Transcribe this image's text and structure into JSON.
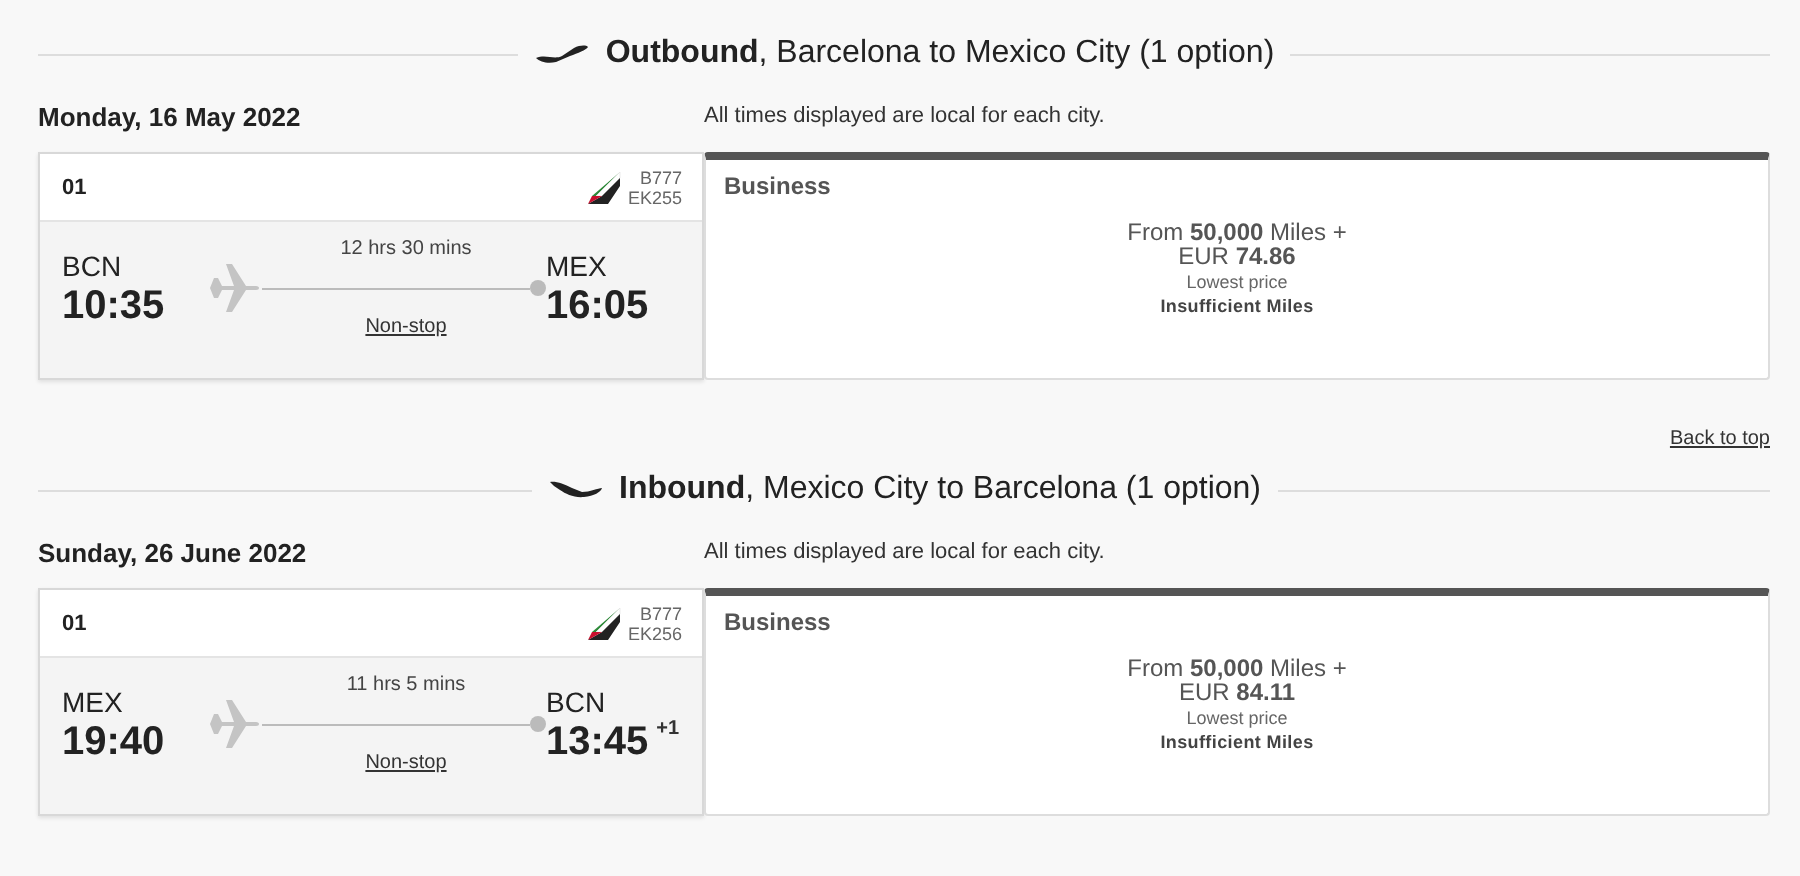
{
  "sections": [
    {
      "kind": "outbound",
      "heading": "**Outbound**, Barcelona to Mexico City (1 option)",
      "date": "Monday, 16 May 2022",
      "note": "All times displayed are local for each city.",
      "flight": {
        "number": "01",
        "aircraft": "B777",
        "flight_no": "EK255",
        "origin": {
          "code": "BCN",
          "time": "10:35"
        },
        "destination": {
          "code": "MEX",
          "time": "16:05"
        },
        "duration": "12 hrs 30 mins",
        "stops": "Non-stop"
      },
      "fare": {
        "cabin": "Business",
        "price_miles": "From **50,000** Miles +",
        "price_cash": "EUR **74.86**",
        "price_note": "Lowest price",
        "status": "Insufficient Miles"
      },
      "back_to_top": "Back to top"
    },
    {
      "kind": "inbound",
      "heading": "**Inbound**, Mexico City to Barcelona (1 option)",
      "date": "Sunday, 26 June 2022",
      "note": "All times displayed are local for each city.",
      "flight": {
        "number": "01",
        "aircraft": "B777",
        "flight_no": "EK256",
        "origin": {
          "code": "MEX",
          "time": "19:40"
        },
        "destination": {
          "code": "BCN",
          "time": "13:45",
          "day_offset": "+1"
        },
        "duration": "11 hrs 5 mins",
        "stops": "Non-stop"
      },
      "fare": {
        "cabin": "Business",
        "price_miles": "From **50,000** Miles +",
        "price_cash": "EUR **84.11**",
        "price_note": "Lowest price",
        "status": "Insufficient Miles"
      }
    }
  ]
}
